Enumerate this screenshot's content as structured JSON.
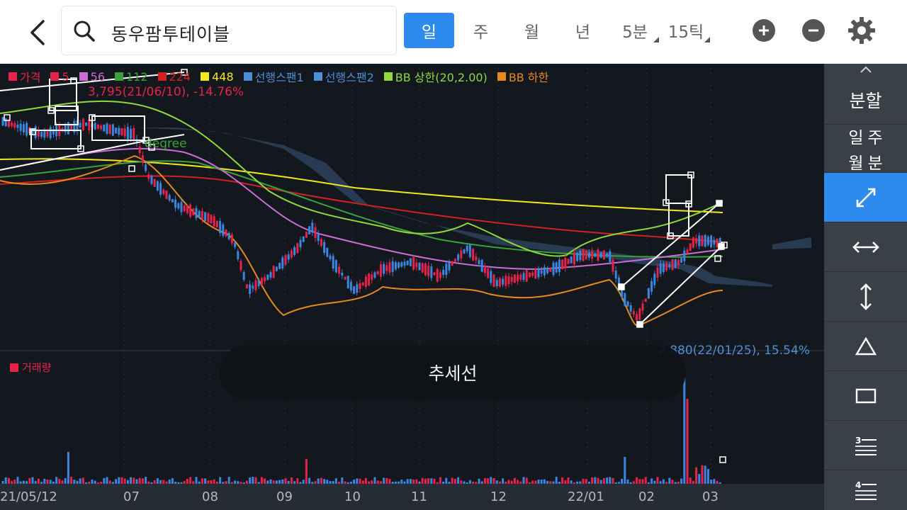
{
  "search": {
    "query": "동우팜투테이블"
  },
  "periods": [
    {
      "label": "일",
      "active": true
    },
    {
      "label": "주",
      "active": false
    },
    {
      "label": "월",
      "active": false
    },
    {
      "label": "년",
      "active": false
    },
    {
      "label": "5분",
      "active": false
    },
    {
      "label": "15틱",
      "active": false
    }
  ],
  "top_icons": [
    "back-arrow-icon",
    "search-icon",
    "zoom-in-icon",
    "zoom-out-icon",
    "gear-icon"
  ],
  "legend": [
    {
      "label": "가격",
      "color": "#e8224a"
    },
    {
      "label": "5",
      "color": "#e8224a"
    },
    {
      "label": "56",
      "color": "#c86ed6"
    },
    {
      "label": "112",
      "color": "#3aa23a"
    },
    {
      "label": "224",
      "color": "#d42020"
    },
    {
      "label": "448",
      "color": "#f2e81c"
    },
    {
      "label": "선행스팬1",
      "color": "#4d8fd6"
    },
    {
      "label": "선행스팬2",
      "color": "#4d8fd6"
    },
    {
      "label": "BB 상한(20,2.00)",
      "color": "#8fd93a"
    },
    {
      "label": "BB 하한",
      "color": "#e8891c"
    }
  ],
  "annotations": {
    "high": "3,795(21/06/10), -14.76%",
    "low": "2,880(22/01/25), 15.54%",
    "degree": "degree"
  },
  "volume_label": "거래량",
  "x_axis": [
    "21/05/12",
    "07",
    "08",
    "09",
    "10",
    "11",
    "12",
    "22/01",
    "02",
    "03"
  ],
  "toast": "추세선",
  "toolbar": {
    "split": "분할",
    "periods": [
      "일",
      "주",
      "월",
      "분"
    ],
    "tools": [
      "trendline-icon",
      "horizontal-line-icon",
      "vertical-line-icon",
      "triangle-icon",
      "rectangle-icon",
      "fibonacci-3-icon",
      "fibonacci-4-icon"
    ]
  },
  "chart_data": {
    "type": "candlestick",
    "title": "",
    "lines": [
      "5",
      "56",
      "112",
      "224",
      "448",
      "선행스팬1",
      "선행스팬2",
      "BB 상한(20,2.00)",
      "BB 하한"
    ],
    "high_marker": {
      "price": 3795,
      "date": "21/06/10",
      "change_pct": -14.76
    },
    "low_marker": {
      "price": 2880,
      "date": "22/01/25",
      "change_pct": 15.54
    },
    "x_ticks": [
      "21/05/12",
      "07",
      "08",
      "09",
      "10",
      "11",
      "12",
      "22/01",
      "02",
      "03"
    ]
  }
}
